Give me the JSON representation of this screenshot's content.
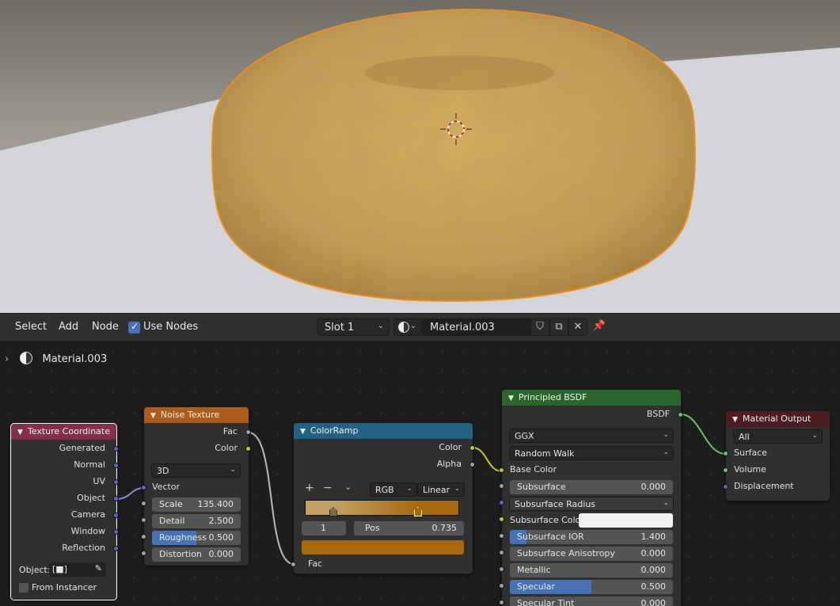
{
  "header": {
    "menus": [
      "Select",
      "Add",
      "Node"
    ],
    "use_nodes_label": "Use Nodes",
    "use_nodes_checked": true,
    "slot_label": "Slot 1",
    "material_name": "Material.003"
  },
  "breadcrumb": {
    "material": "Material.003"
  },
  "nodes": {
    "texture_coordinate": {
      "title": "Texture Coordinate",
      "outputs": [
        "Generated",
        "Normal",
        "UV",
        "Object",
        "Camera",
        "Window",
        "Reflection"
      ],
      "object_label": "Object:",
      "from_instancer_label": "From Instancer"
    },
    "noise_texture": {
      "title": "Noise Texture",
      "outputs": [
        "Fac",
        "Color"
      ],
      "dimensions": "3D",
      "vector_label": "Vector",
      "fields": [
        {
          "label": "Scale",
          "value": "135.400"
        },
        {
          "label": "Detail",
          "value": "2.500"
        },
        {
          "label": "Roughness",
          "value": "0.500",
          "fill": 0.5
        },
        {
          "label": "Distortion",
          "value": "0.000"
        }
      ]
    },
    "colorramp": {
      "title": "ColorRamp",
      "outputs": [
        "Color",
        "Alpha"
      ],
      "color_mode": "RGB",
      "interpolation": "Linear",
      "active_index": "1",
      "pos_label": "Pos",
      "pos_value": "0.735",
      "stop_positions": [
        0.18,
        0.735
      ],
      "fac_label": "Fac",
      "colors": {
        "left": "#c2a166",
        "right": "#a8690e"
      }
    },
    "principled_bsdf": {
      "title": "Principled BSDF",
      "output": "BSDF",
      "distribution": "GGX",
      "subsurface_method": "Random Walk",
      "base_color_label": "Base Color",
      "subsurface_radius_label": "Subsurface Radius",
      "subsurface_color_label": "Subsurface Colo",
      "fields": [
        {
          "label": "Subsurface",
          "value": "0.000",
          "fill": 0
        },
        {
          "label": "Subsurface IOR",
          "value": "1.400",
          "fill": 0.1
        },
        {
          "label": "Subsurface Anisotropy",
          "value": "0.000",
          "fill": 0
        },
        {
          "label": "Metallic",
          "value": "0.000",
          "fill": 0
        },
        {
          "label": "Specular",
          "value": "0.500",
          "fill": 0.5
        },
        {
          "label": "Specular Tint",
          "value": "0.000",
          "fill": 0
        }
      ]
    },
    "material_output": {
      "title": "Material Output",
      "target": "All",
      "inputs": [
        "Surface",
        "Volume",
        "Displacement"
      ]
    }
  },
  "colors": {
    "texture_header": "#83314a",
    "input_header": "#ae5c1b",
    "converter_header": "#246283",
    "shader_header": "#2b652b",
    "output_header": "#4b1c24",
    "selected_outline": "#ffffff",
    "accent": "#4772b3"
  }
}
